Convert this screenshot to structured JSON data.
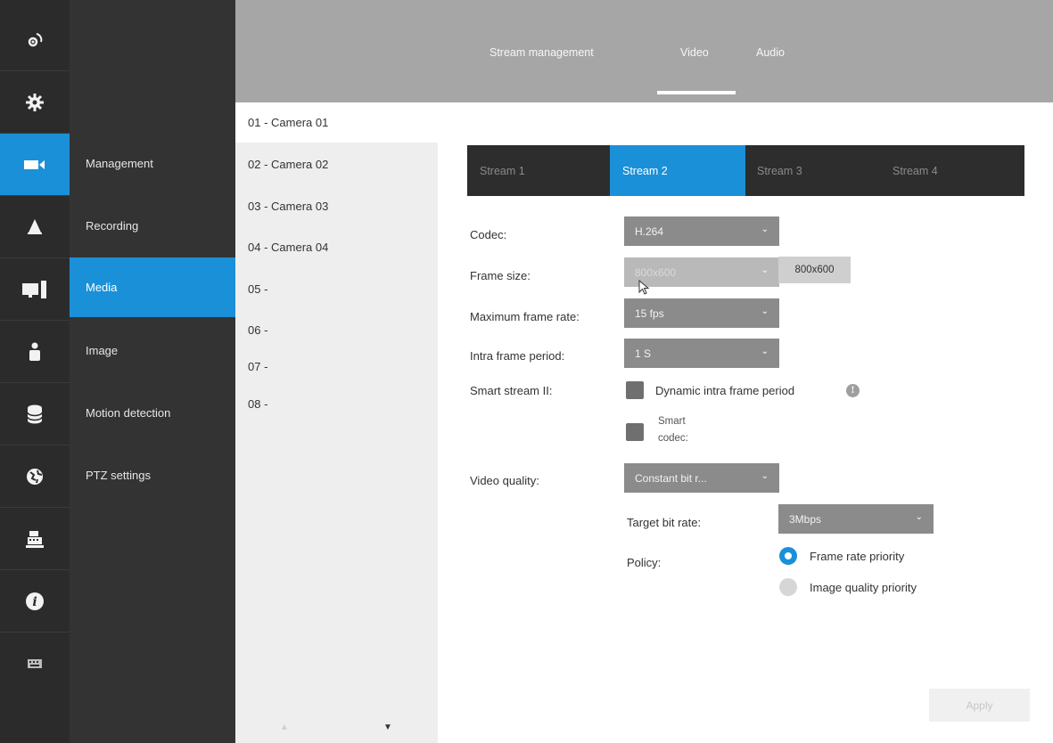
{
  "rail": {
    "icons": [
      "live-view-icon",
      "gear-icon",
      "camera-icon",
      "bell-icon",
      "display-icon",
      "user-icon",
      "database-icon",
      "network-icon",
      "cash-register-icon",
      "info-icon",
      "keyboard-icon"
    ],
    "active_index": 2,
    "accent_color": "#1a90d9"
  },
  "submenu": {
    "items": [
      {
        "label": "Management"
      },
      {
        "label": "Recording"
      },
      {
        "label": "Media"
      },
      {
        "label": "Image"
      },
      {
        "label": "Motion detection"
      },
      {
        "label": "PTZ settings"
      }
    ],
    "active_label": "Media"
  },
  "topbar": {
    "tabs": [
      {
        "label": "Stream management"
      },
      {
        "label": "Video"
      },
      {
        "label": "Audio"
      }
    ],
    "active_tab": "Video"
  },
  "cameras": {
    "items": [
      {
        "label": "01 - Camera 01"
      },
      {
        "label": "02 - Camera 02"
      },
      {
        "label": "03 - Camera 03"
      },
      {
        "label": "04 - Camera 04"
      },
      {
        "label": "05 -"
      },
      {
        "label": "06 -"
      },
      {
        "label": "07 -"
      },
      {
        "label": "08 -"
      }
    ],
    "active_label": "01 - Camera 01"
  },
  "streams": {
    "tabs": [
      {
        "label": "Stream 1"
      },
      {
        "label": "Stream 2"
      },
      {
        "label": "Stream 3"
      },
      {
        "label": "Stream 4"
      }
    ],
    "active_tab": "Stream 2"
  },
  "form": {
    "codec": {
      "label": "Codec:",
      "value": "H.264"
    },
    "frame_size": {
      "label": "Frame size:",
      "value": "800x600",
      "tooltip": "800x600"
    },
    "max_frame_rate": {
      "label": "Maximum frame rate:",
      "value": "15 fps"
    },
    "intra_frame_period": {
      "label": "Intra frame period:",
      "value": "1 S"
    },
    "smart_stream": {
      "label": "Smart stream II:",
      "dynamic_intra_label": "Dynamic intra frame period",
      "smart_codec_label_line1": "Smart",
      "smart_codec_label_line2": "codec:"
    },
    "video_quality": {
      "label": "Video quality:",
      "value": "Constant bit r..."
    },
    "target_bit_rate": {
      "label": "Target bit rate:",
      "value": "3Mbps"
    },
    "policy": {
      "label": "Policy:",
      "options": [
        "Frame rate priority",
        "Image quality priority"
      ],
      "selected": "Frame rate priority"
    }
  },
  "actions": {
    "apply_label": "Apply"
  }
}
